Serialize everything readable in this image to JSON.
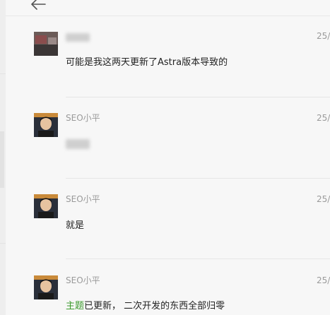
{
  "messages": [
    {
      "sender": "",
      "date": "25/",
      "text": "可能是我这两天更新了Astra版本导致的"
    },
    {
      "sender": "SEO小平",
      "date": "25/",
      "text": ""
    },
    {
      "sender": "SEO小平",
      "date": "25/",
      "text": "就是"
    },
    {
      "sender": "SEO小平",
      "date": "25/",
      "text_link": "主题",
      "text_rest": "已更新， 二次开发的东西全部归零"
    }
  ],
  "colors": {
    "background": "#f7f7f7",
    "link_green": "#3b9a2c",
    "meta_gray": "#9a9a9a"
  }
}
